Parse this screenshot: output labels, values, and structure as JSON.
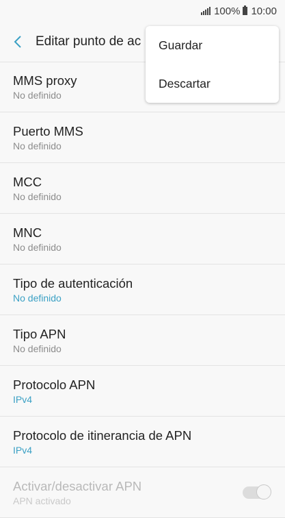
{
  "status_bar": {
    "battery": "100%",
    "time": "10:00"
  },
  "header": {
    "title": "Editar punto de ac"
  },
  "menu": {
    "items": [
      {
        "label": "Guardar"
      },
      {
        "label": "Descartar"
      }
    ]
  },
  "settings": [
    {
      "title": "MMS proxy",
      "value": "No definido"
    },
    {
      "title": "Puerto MMS",
      "value": "No definido"
    },
    {
      "title": "MCC",
      "value": "No definido"
    },
    {
      "title": "MNC",
      "value": "No definido"
    },
    {
      "title": "Tipo de autenticación",
      "value": "No definido"
    },
    {
      "title": "Tipo APN",
      "value": "No definido"
    },
    {
      "title": "Protocolo APN",
      "value": "IPv4"
    },
    {
      "title": "Protocolo de itinerancia de APN",
      "value": "IPv4"
    },
    {
      "title": "Activar/desactivar APN",
      "value": "APN activado",
      "enabled": true
    }
  ],
  "colors": {
    "accent": "#3aa0c4",
    "background": "#f8f8f8"
  },
  "icons": {
    "back": "chevron-left-icon",
    "signal": "signal-icon",
    "battery": "battery-icon"
  }
}
